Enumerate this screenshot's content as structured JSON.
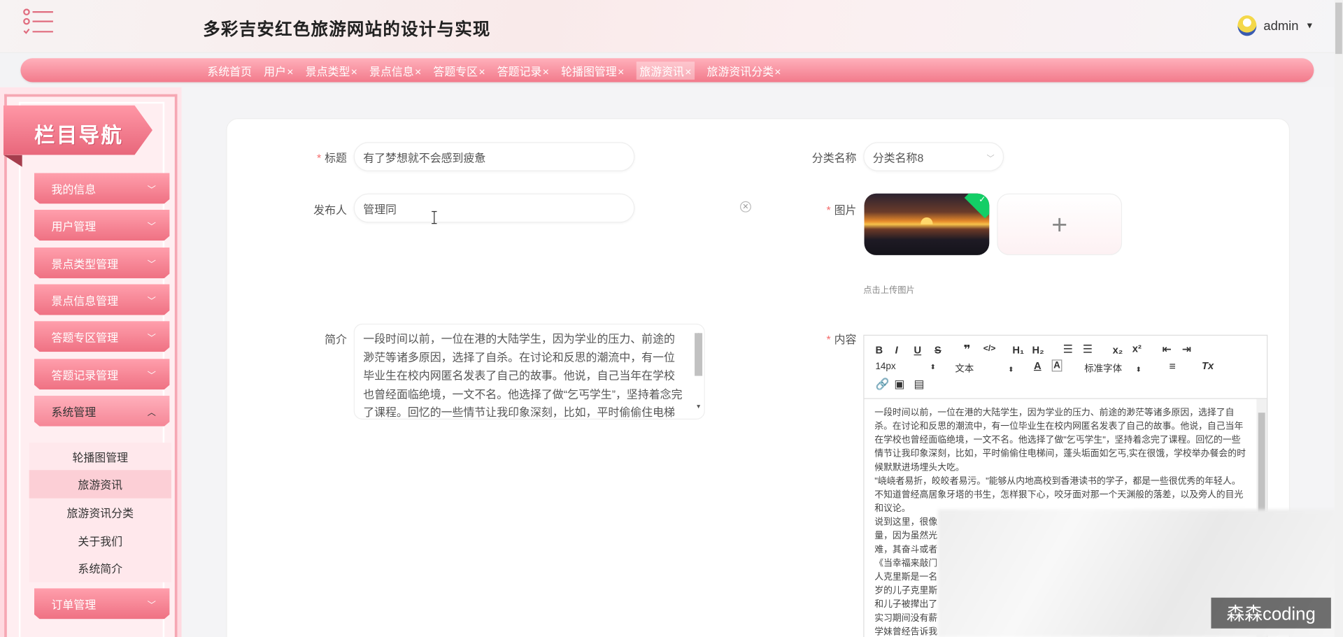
{
  "header": {
    "site_title": "多彩吉安红色旅游网站的设计与实现",
    "username": "admin"
  },
  "tabs": [
    {
      "label": "系统首页",
      "closable": false
    },
    {
      "label": "用户",
      "closable": true
    },
    {
      "label": "景点类型",
      "closable": true
    },
    {
      "label": "景点信息",
      "closable": true
    },
    {
      "label": "答题专区",
      "closable": true
    },
    {
      "label": "答题记录",
      "closable": true
    },
    {
      "label": "轮播图管理",
      "closable": true
    },
    {
      "label": "旅游资讯",
      "closable": true,
      "active": true
    },
    {
      "label": "旅游资讯分类",
      "closable": true
    }
  ],
  "tab_close_glyph": "×",
  "sidebar": {
    "banner": "栏目导航",
    "menu": [
      {
        "label": "我的信息"
      },
      {
        "label": "用户管理"
      },
      {
        "label": "景点类型管理"
      },
      {
        "label": "景点信息管理"
      },
      {
        "label": "答题专区管理"
      },
      {
        "label": "答题记录管理"
      },
      {
        "label": "系统管理",
        "open": true
      },
      {
        "label": "订单管理"
      }
    ],
    "submenu": [
      {
        "label": "轮播图管理"
      },
      {
        "label": "旅游资讯",
        "active": true
      },
      {
        "label": "旅游资讯分类"
      },
      {
        "label": "关于我们"
      },
      {
        "label": "系统简介"
      }
    ]
  },
  "form": {
    "title_label": "标题",
    "title_value": "有了梦想就不会感到疲惫",
    "category_label": "分类名称",
    "category_value": "分类名称8",
    "publisher_label": "发布人",
    "publisher_value": "管理同",
    "image_label": "图片",
    "upload_tip": "点击上传图片",
    "summary_label": "简介",
    "summary_value": "一段时间以前，一位在港的大陆学生，因为学业的压力、前途的渺茫等诸多原因，选择了自杀。在讨论和反思的潮流中，有一位毕业生在校内网匿名发表了自己的故事。他说，自己当年在学校也曾经面临绝境，一文不名。他选择了做“乞丐学生”，坚持着念完了课程。回忆的一些情节让我印象深刻，比如，平时偷偷住电梯间，蓬头垢面如乞丐",
    "content_label": "内容",
    "content_value": "一段时间以前，一位在港的大陆学生，因为学业的压力、前途的渺茫等诸多原因，选择了自杀。在讨论和反思的潮流中，有一位毕业生在校内网匿名发表了自己的故事。他说，自己当年在学校也曾经面临绝境，一文不名。他选择了做\"乞丐学生\"，坚持着念完了课程。回忆的一些情节让我印象深刻，比如，平时偷偷住电梯间，蓬头垢面如乞丐,实在很饿，学校举办餐会的时候默默进场埋头大吃。\n\"峣峣者易折，皎皎者易污。\"能够从内地高校到香港读书的学子，都是一些很优秀的年轻人。不知道曾经高居象牙塔的书生，怎样狠下心，咬牙面对那一个天渊般的落差，以及旁人的目光和议论。\n说到这里，很像\n量，因为虽然光\n难，其奋斗或者\n《当幸福来敲门\n人克里斯是一名\n岁的儿子克里斯\n和儿子被撵出了\n实习期间没有薪\n学妹曾经告诉我\n一个中学要招几"
  },
  "editor": {
    "font_size": "14px",
    "paragraph": "文本",
    "font_family": "标准字体"
  },
  "watermark": "森森coding"
}
